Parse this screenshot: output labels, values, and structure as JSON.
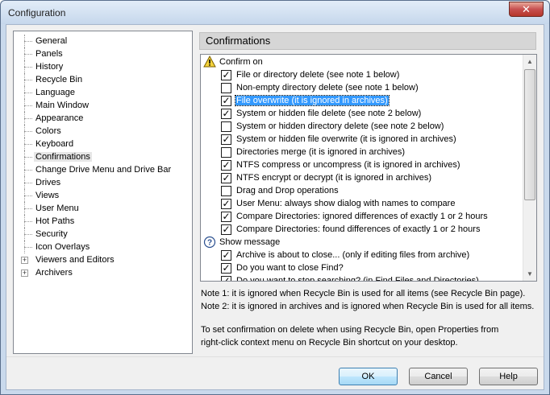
{
  "window": {
    "title": "Configuration",
    "close_label": "✕"
  },
  "tree": {
    "items": [
      {
        "label": "General",
        "expandable": false
      },
      {
        "label": "Panels",
        "expandable": false
      },
      {
        "label": "History",
        "expandable": false
      },
      {
        "label": "Recycle Bin",
        "expandable": false
      },
      {
        "label": "Language",
        "expandable": false
      },
      {
        "label": "Main Window",
        "expandable": false
      },
      {
        "label": "Appearance",
        "expandable": false
      },
      {
        "label": "Colors",
        "expandable": false
      },
      {
        "label": "Keyboard",
        "expandable": false
      },
      {
        "label": "Confirmations",
        "expandable": false,
        "selected": true
      },
      {
        "label": "Change Drive Menu and Drive Bar",
        "expandable": false
      },
      {
        "label": "Drives",
        "expandable": false
      },
      {
        "label": "Views",
        "expandable": false
      },
      {
        "label": "User Menu",
        "expandable": false
      },
      {
        "label": "Hot Paths",
        "expandable": false
      },
      {
        "label": "Security",
        "expandable": false
      },
      {
        "label": "Icon Overlays",
        "expandable": false
      },
      {
        "label": "Viewers and Editors",
        "expandable": true
      },
      {
        "label": "Archivers",
        "expandable": true
      }
    ],
    "expander_symbol": "+"
  },
  "panel": {
    "header": "Confirmations",
    "groups": [
      {
        "label": "Confirm on",
        "icon": "warning-icon",
        "items": [
          {
            "label": "File or directory delete (see note 1 below)",
            "checked": true
          },
          {
            "label": "Non-empty directory delete (see note 1 below)",
            "checked": false
          },
          {
            "label": "File overwrite (it is ignored in archives)",
            "checked": true,
            "focused": true
          },
          {
            "label": "System or hidden file delete (see note 2 below)",
            "checked": true
          },
          {
            "label": "System or hidden directory delete (see note 2 below)",
            "checked": false
          },
          {
            "label": "System or hidden file overwrite (it is ignored in archives)",
            "checked": true
          },
          {
            "label": "Directories merge (it is ignored in archives)",
            "checked": false
          },
          {
            "label": "NTFS compress or uncompress (it is ignored in archives)",
            "checked": true
          },
          {
            "label": "NTFS encrypt or decrypt (it is ignored in archives)",
            "checked": true
          },
          {
            "label": "Drag and Drop operations",
            "checked": false
          },
          {
            "label": "User Menu: always show dialog with names to compare",
            "checked": true
          },
          {
            "label": "Compare Directories: ignored differences of exactly 1 or 2 hours",
            "checked": true
          },
          {
            "label": "Compare Directories: found differences of exactly 1 or 2 hours",
            "checked": true
          }
        ]
      },
      {
        "label": "Show message",
        "icon": "question-icon",
        "items": [
          {
            "label": "Archive is about to close... (only if editing files from archive)",
            "checked": true
          },
          {
            "label": "Do you want to close Find?",
            "checked": true
          },
          {
            "label": "Do you want to stop searching? (in Find Files and Directories)",
            "checked": true
          }
        ]
      }
    ],
    "check_mark": "✓"
  },
  "notes": {
    "note1": "Note 1: it is ignored when Recycle Bin is used for all items (see Recycle Bin page).",
    "note2": "Note 2: it is ignored in archives and is ignored when Recycle Bin is used for all items.",
    "hint_line1": "To set confirmation on delete when using Recycle Bin, open Properties from",
    "hint_line2": "right-click context menu on Recycle Bin shortcut on your desktop."
  },
  "buttons": {
    "ok": "OK",
    "cancel": "Cancel",
    "help": "Help"
  },
  "scrollbar": {
    "up_arrow": "▲",
    "down_arrow": "▼"
  },
  "colors": {
    "selection": "#3399ff",
    "window_frame": "#c9d9ec",
    "close_button": "#c75050"
  }
}
